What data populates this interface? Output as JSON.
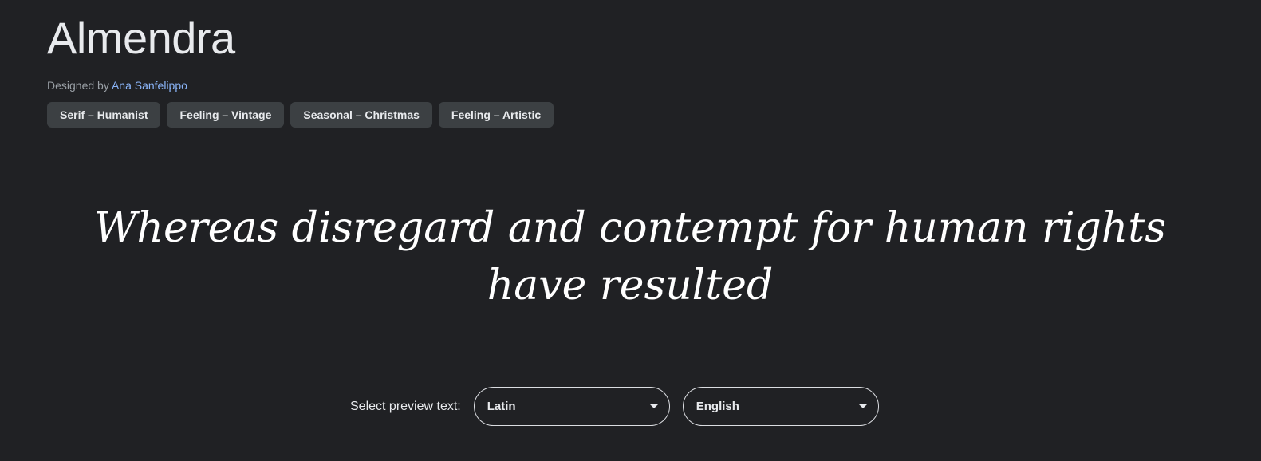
{
  "font": {
    "name": "Almendra",
    "designed_by_label": "Designed by",
    "designer": "Ana Sanfelippo"
  },
  "tags": [
    {
      "label": "Serif – Humanist"
    },
    {
      "label": "Feeling – Vintage"
    },
    {
      "label": "Seasonal – Christmas"
    },
    {
      "label": "Feeling – Artistic"
    }
  ],
  "preview": {
    "text": "Whereas disregard and contempt for human rights have resulted"
  },
  "selector": {
    "label": "Select preview text:",
    "script_value": "Latin",
    "language_value": "English"
  },
  "colors": {
    "background": "#202124",
    "tag_background": "#3c4043",
    "link": "#8ab4f8"
  }
}
